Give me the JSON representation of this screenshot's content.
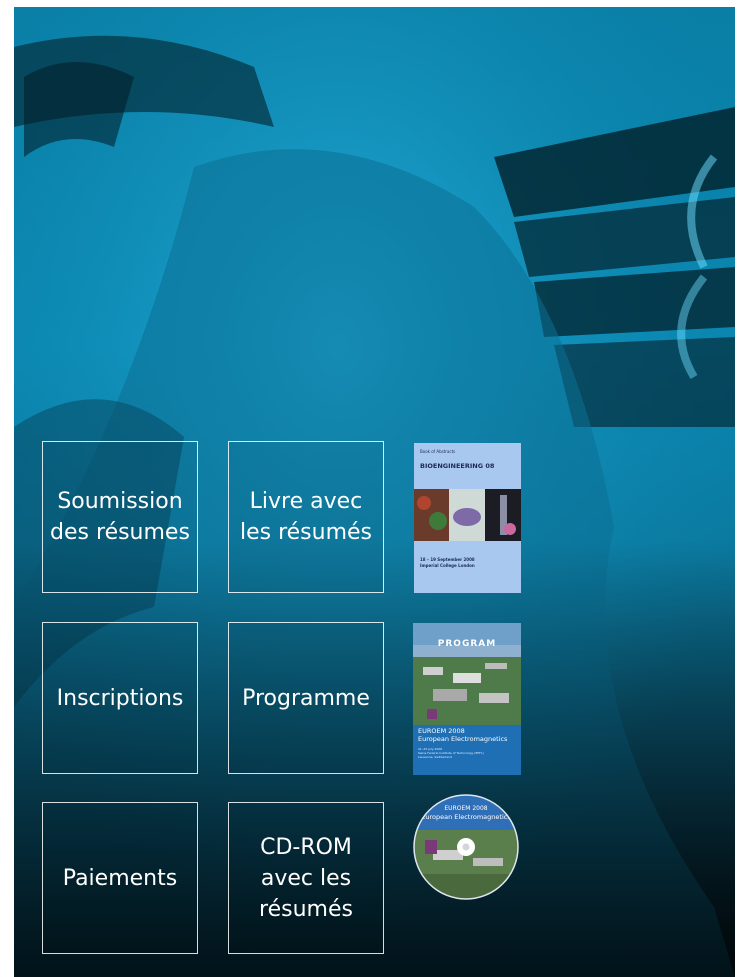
{
  "tiles": {
    "abstract_submission": "Soumission\ndes résumes",
    "abstract_book": "Livre avec\nles résumés",
    "registration": "Inscriptions",
    "programme": "Programme",
    "payments": "Paiements",
    "cdrom": "CD-ROM\navec les\nrésumés"
  },
  "covers": {
    "abstracts": {
      "header": "Book of Abstracts",
      "title": "BIOENGINEERING 08",
      "date": "18 – 19 September 2008\nImperial College London"
    },
    "program": {
      "title": "PROGRAM",
      "event": "EUROEM 2008",
      "subtitle": "European Electromagnetics",
      "details": "21–25 July 2008\nSwiss Federal Institute of Technology (EPFL)\nLausanne, Switzerland"
    },
    "cd": {
      "event": "EUROEM 2008",
      "subtitle": "European Electromagnetics"
    }
  },
  "colors": {
    "poster_cyan": "#0a86b0",
    "tile_border": "#ffffff",
    "abstract_cover": "#a9c8ef",
    "program_cover": "#1f6fb5"
  }
}
